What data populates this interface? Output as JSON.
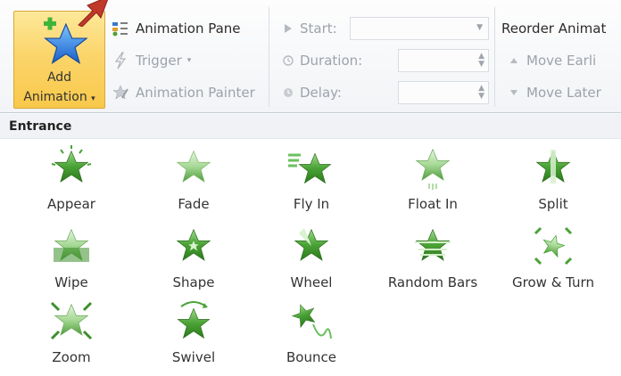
{
  "ribbon": {
    "add_animation": {
      "line1": "Add",
      "line2": "Animation",
      "dropdown": "▾"
    },
    "animation_pane": "Animation Pane",
    "trigger": "Trigger",
    "trigger_dropdown": "▾",
    "animation_painter": "Animation Painter",
    "start_label": "Start:",
    "duration_label": "Duration:",
    "delay_label": "Delay:",
    "reorder_label": "Reorder Animat",
    "move_earlier": "Move Earli",
    "move_later": "Move Later"
  },
  "gallery": {
    "section": "Entrance",
    "effects": [
      {
        "name": "Appear",
        "icon": "appear-star-icon"
      },
      {
        "name": "Fade",
        "icon": "fade-star-icon"
      },
      {
        "name": "Fly In",
        "icon": "fly-in-star-icon"
      },
      {
        "name": "Float In",
        "icon": "float-in-star-icon"
      },
      {
        "name": "Split",
        "icon": "split-star-icon"
      },
      {
        "name": "Wipe",
        "icon": "wipe-star-icon"
      },
      {
        "name": "Shape",
        "icon": "shape-star-icon"
      },
      {
        "name": "Wheel",
        "icon": "wheel-star-icon"
      },
      {
        "name": "Random Bars",
        "icon": "random-bars-star-icon"
      },
      {
        "name": "Grow & Turn",
        "icon": "grow-turn-star-icon"
      },
      {
        "name": "Zoom",
        "icon": "zoom-star-icon"
      },
      {
        "name": "Swivel",
        "icon": "swivel-star-icon"
      },
      {
        "name": "Bounce",
        "icon": "bounce-star-icon"
      }
    ]
  },
  "colors": {
    "star_green_dark": "#2e7d1f",
    "star_green_light": "#8fd07a",
    "button_highlight": "#fbd56b",
    "arrow_red": "#c0392b"
  }
}
